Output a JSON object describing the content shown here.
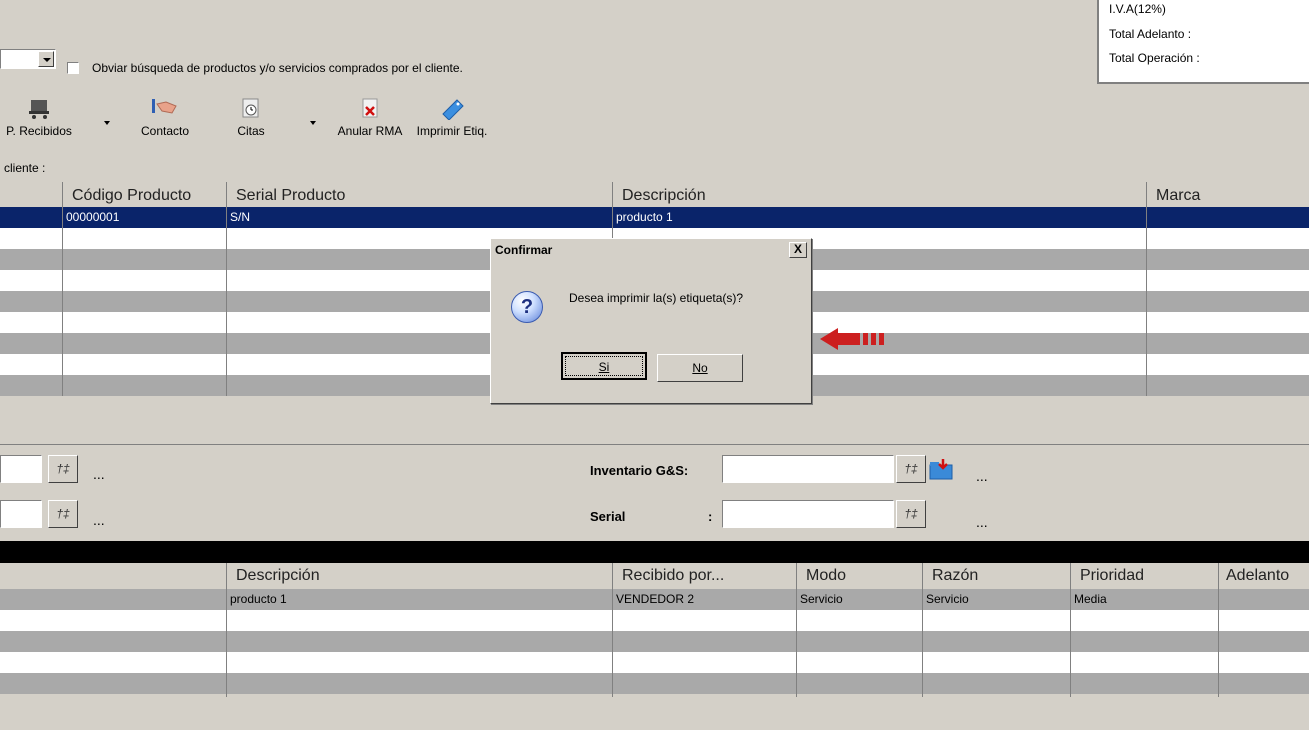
{
  "top": {
    "checkbox_label": "Obviar búsqueda de productos y/o servicios comprados por el cliente."
  },
  "totals": {
    "iva": "I.V.A(12%)",
    "adelanto": "Total Adelanto :",
    "operacion": "Total Operación :"
  },
  "toolbar": [
    {
      "label": "P. Recibidos",
      "icon": "cart-icon"
    },
    {
      "label": "Contacto",
      "icon": "handshake-icon"
    },
    {
      "label": "Citas",
      "icon": "clock-icon"
    },
    {
      "label": "Anular RMA",
      "icon": "cancel-x-icon"
    },
    {
      "label": "Imprimir Etiq.",
      "icon": "label-tag-icon"
    }
  ],
  "client_label": "cliente :",
  "grid1": {
    "headers": [
      "Código Producto",
      "Serial Producto",
      "Descripción",
      "Marca"
    ],
    "selected_row": [
      "00000001",
      "S/N",
      "producto 1"
    ]
  },
  "dialog": {
    "title": "Confirmar",
    "close": "X",
    "message": "Desea imprimir la(s) etiqueta(s)?",
    "yes": "Si",
    "no": "No",
    "accent": "#cc1f1f"
  },
  "fields": {
    "inventario_label": "Inventario G&S:",
    "serial_label": "Serial",
    "serial_colon": ":",
    "ellipsis": "..."
  },
  "grid2": {
    "headers": [
      "Descripción",
      "Recibido por...",
      "Modo",
      "Razón",
      "Prioridad",
      "Adelanto"
    ],
    "row": [
      "producto 1",
      "VENDEDOR 2",
      "Servicio",
      "Servicio",
      "Media"
    ]
  },
  "colors": {
    "selection": "#0a246a",
    "face": "#d4d0c8",
    "stripe": "#a9a9a9"
  }
}
